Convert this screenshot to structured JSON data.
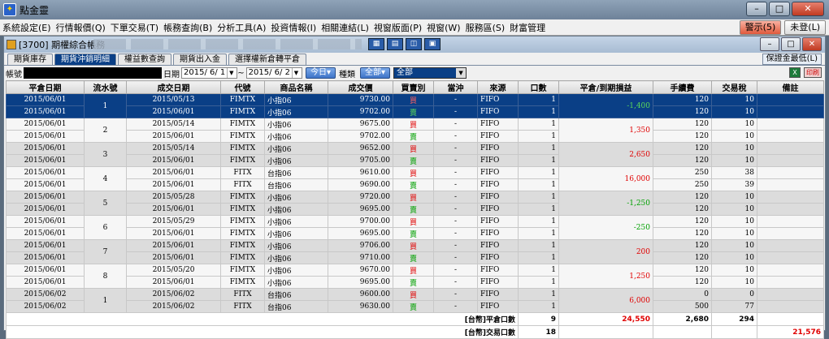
{
  "app": {
    "icon_glyph": "✦",
    "title": "點金靈"
  },
  "window_buttons": {
    "minimize": "–",
    "maximize": "□",
    "close": "✕"
  },
  "menu": {
    "items": [
      "系統設定(E)",
      "行情報價(Q)",
      "下單交易(T)",
      "帳務查詢(B)",
      "分析工具(A)",
      "投資情報(I)",
      "相關連結(L)",
      "視窗版面(P)",
      "視窗(W)",
      "服務區(S)",
      "財富管理"
    ],
    "alert_label": "警示(5)",
    "login_label": "未登(L)"
  },
  "child": {
    "title": "[3700] 期權綜合帳務",
    "tool_glyphs": [
      "▦",
      "▤",
      "◫",
      "▣"
    ],
    "win_buttons": {
      "minimize": "–",
      "maximize": "□",
      "close": "✕"
    }
  },
  "tabs": {
    "items": [
      "期貨庫存",
      "期貨沖銷明細",
      "權益數查詢",
      "期貨出入金",
      "選擇權新倉轉平倉"
    ],
    "active_index": 1,
    "right_label": "保證金最低(L)"
  },
  "filter": {
    "account_label": "帳號",
    "date_label": "日期",
    "date_from": "2015/ 6/ 1",
    "date_sep": "~",
    "date_to": "2015/ 6/ 2",
    "dropdown_glyph": "▼",
    "today_button": "今日▾",
    "type_label": "種類",
    "type_value": "全部▾",
    "product_value": "全部"
  },
  "icons": {
    "excel": "X",
    "print": "印刷"
  },
  "table": {
    "headers": [
      "平倉日期",
      "流水號",
      "成交日期",
      "代號",
      "商品名稱",
      "成交價",
      "買賣別",
      "當沖",
      "來源",
      "口數",
      "平倉/到期損益",
      "手續費",
      "交易稅",
      "備註"
    ],
    "groups": [
      {
        "serial": "1",
        "pnl": "-1,400",
        "pnl_color": "green",
        "rows": [
          {
            "close_date": "2015/06/01",
            "trade_date": "2015/05/13",
            "code": "FIMTX",
            "name": "小指06",
            "price": "9730.00",
            "side": "買",
            "side_color": "red",
            "daytrade": "-",
            "source": "FIFO",
            "qty": "1",
            "fee": "120",
            "tax": "10",
            "note": ""
          },
          {
            "close_date": "2015/06/01",
            "trade_date": "2015/06/01",
            "code": "FIMTX",
            "name": "小指06",
            "price": "9702.00",
            "side": "賣",
            "side_color": "green",
            "daytrade": "-",
            "source": "FIFO",
            "qty": "1",
            "fee": "120",
            "tax": "10",
            "note": ""
          }
        ]
      },
      {
        "serial": "2",
        "pnl": "1,350",
        "pnl_color": "red",
        "rows": [
          {
            "close_date": "2015/06/01",
            "trade_date": "2015/05/14",
            "code": "FIMTX",
            "name": "小指06",
            "price": "9675.00",
            "side": "買",
            "side_color": "red",
            "daytrade": "-",
            "source": "FIFO",
            "qty": "1",
            "fee": "120",
            "tax": "10",
            "note": ""
          },
          {
            "close_date": "2015/06/01",
            "trade_date": "2015/06/01",
            "code": "FIMTX",
            "name": "小指06",
            "price": "9702.00",
            "side": "賣",
            "side_color": "green",
            "daytrade": "-",
            "source": "FIFO",
            "qty": "1",
            "fee": "120",
            "tax": "10",
            "note": ""
          }
        ]
      },
      {
        "serial": "3",
        "pnl": "2,650",
        "pnl_color": "red",
        "rows": [
          {
            "close_date": "2015/06/01",
            "trade_date": "2015/05/14",
            "code": "FIMTX",
            "name": "小指06",
            "price": "9652.00",
            "side": "買",
            "side_color": "red",
            "daytrade": "-",
            "source": "FIFO",
            "qty": "1",
            "fee": "120",
            "tax": "10",
            "note": ""
          },
          {
            "close_date": "2015/06/01",
            "trade_date": "2015/06/01",
            "code": "FIMTX",
            "name": "小指06",
            "price": "9705.00",
            "side": "賣",
            "side_color": "green",
            "daytrade": "-",
            "source": "FIFO",
            "qty": "1",
            "fee": "120",
            "tax": "10",
            "note": ""
          }
        ]
      },
      {
        "serial": "4",
        "pnl": "16,000",
        "pnl_color": "red",
        "rows": [
          {
            "close_date": "2015/06/01",
            "trade_date": "2015/06/01",
            "code": "FITX",
            "name": "台指06",
            "price": "9610.00",
            "side": "買",
            "side_color": "red",
            "daytrade": "-",
            "source": "FIFO",
            "qty": "1",
            "fee": "250",
            "tax": "38",
            "note": ""
          },
          {
            "close_date": "2015/06/01",
            "trade_date": "2015/06/01",
            "code": "FITX",
            "name": "台指06",
            "price": "9690.00",
            "side": "賣",
            "side_color": "green",
            "daytrade": "-",
            "source": "FIFO",
            "qty": "1",
            "fee": "250",
            "tax": "39",
            "note": ""
          }
        ]
      },
      {
        "serial": "5",
        "pnl": "-1,250",
        "pnl_color": "green",
        "rows": [
          {
            "close_date": "2015/06/01",
            "trade_date": "2015/05/28",
            "code": "FIMTX",
            "name": "小指06",
            "price": "9720.00",
            "side": "買",
            "side_color": "red",
            "daytrade": "-",
            "source": "FIFO",
            "qty": "1",
            "fee": "120",
            "tax": "10",
            "note": ""
          },
          {
            "close_date": "2015/06/01",
            "trade_date": "2015/06/01",
            "code": "FIMTX",
            "name": "小指06",
            "price": "9695.00",
            "side": "賣",
            "side_color": "green",
            "daytrade": "-",
            "source": "FIFO",
            "qty": "1",
            "fee": "120",
            "tax": "10",
            "note": ""
          }
        ]
      },
      {
        "serial": "6",
        "pnl": "-250",
        "pnl_color": "green",
        "rows": [
          {
            "close_date": "2015/06/01",
            "trade_date": "2015/05/29",
            "code": "FIMTX",
            "name": "小指06",
            "price": "9700.00",
            "side": "買",
            "side_color": "red",
            "daytrade": "-",
            "source": "FIFO",
            "qty": "1",
            "fee": "120",
            "tax": "10",
            "note": ""
          },
          {
            "close_date": "2015/06/01",
            "trade_date": "2015/06/01",
            "code": "FIMTX",
            "name": "小指06",
            "price": "9695.00",
            "side": "賣",
            "side_color": "green",
            "daytrade": "-",
            "source": "FIFO",
            "qty": "1",
            "fee": "120",
            "tax": "10",
            "note": ""
          }
        ]
      },
      {
        "serial": "7",
        "pnl": "200",
        "pnl_color": "red",
        "rows": [
          {
            "close_date": "2015/06/01",
            "trade_date": "2015/06/01",
            "code": "FIMTX",
            "name": "小指06",
            "price": "9706.00",
            "side": "買",
            "side_color": "red",
            "daytrade": "-",
            "source": "FIFO",
            "qty": "1",
            "fee": "120",
            "tax": "10",
            "note": ""
          },
          {
            "close_date": "2015/06/01",
            "trade_date": "2015/06/01",
            "code": "FIMTX",
            "name": "小指06",
            "price": "9710.00",
            "side": "賣",
            "side_color": "green",
            "daytrade": "-",
            "source": "FIFO",
            "qty": "1",
            "fee": "120",
            "tax": "10",
            "note": ""
          }
        ]
      },
      {
        "serial": "8",
        "pnl": "1,250",
        "pnl_color": "red",
        "rows": [
          {
            "close_date": "2015/06/01",
            "trade_date": "2015/05/20",
            "code": "FIMTX",
            "name": "小指06",
            "price": "9670.00",
            "side": "買",
            "side_color": "red",
            "daytrade": "-",
            "source": "FIFO",
            "qty": "1",
            "fee": "120",
            "tax": "10",
            "note": ""
          },
          {
            "close_date": "2015/06/01",
            "trade_date": "2015/06/01",
            "code": "FIMTX",
            "name": "小指06",
            "price": "9695.00",
            "side": "賣",
            "side_color": "green",
            "daytrade": "-",
            "source": "FIFO",
            "qty": "1",
            "fee": "120",
            "tax": "10",
            "note": ""
          }
        ]
      },
      {
        "serial": "1",
        "pnl": "6,000",
        "pnl_color": "red",
        "rows": [
          {
            "close_date": "2015/06/02",
            "trade_date": "2015/06/02",
            "code": "FITX",
            "name": "台指06",
            "price": "9600.00",
            "side": "買",
            "side_color": "red",
            "daytrade": "-",
            "source": "FIFO",
            "qty": "1",
            "fee": "0",
            "tax": "0",
            "note": ""
          },
          {
            "close_date": "2015/06/02",
            "trade_date": "2015/06/02",
            "code": "FITX",
            "name": "台指06",
            "price": "9630.00",
            "side": "賣",
            "side_color": "green",
            "daytrade": "-",
            "source": "FIFO",
            "qty": "1",
            "fee": "500",
            "tax": "77",
            "note": ""
          }
        ]
      }
    ],
    "summary": [
      {
        "label": "[台幣]平倉口數",
        "qty": "9",
        "pnl": "24,550",
        "fee": "2,680",
        "tax": "294",
        "note": ""
      },
      {
        "label": "[台幣]交易口數",
        "qty": "18",
        "pnl": "",
        "fee": "",
        "tax": "",
        "note": "21,576"
      }
    ]
  }
}
